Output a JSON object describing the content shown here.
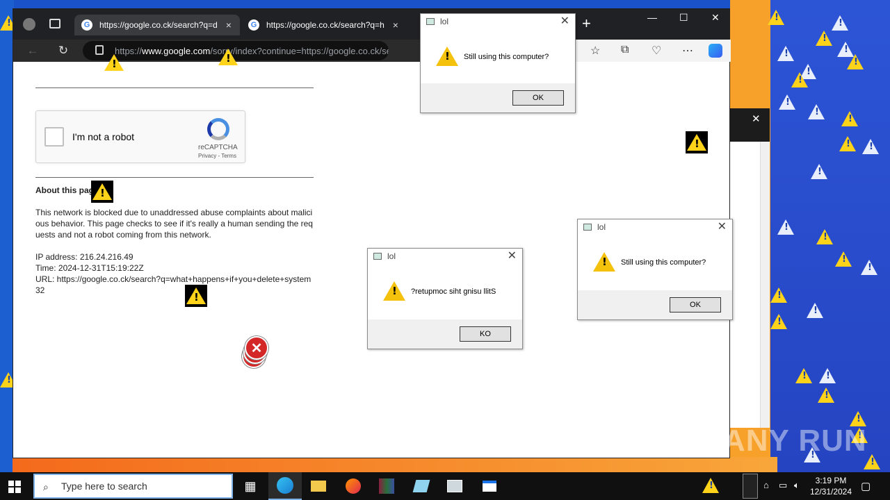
{
  "browser": {
    "tabs": [
      {
        "label": "https://google.co.ck/search?q=d",
        "close": "×"
      },
      {
        "label": "https://google.co.ck/search?q=h",
        "close": "×"
      }
    ],
    "new_tab": "+",
    "url_prefix": "https://",
    "url_domain": "www.google.com",
    "url_rest": "/sorry/index?continue=https://google.co.ck/sear",
    "window_controls": {
      "minimize": "—",
      "maximize": "☐",
      "close": "✕"
    }
  },
  "page": {
    "captcha": {
      "label": "I'm not a robot",
      "brand": "reCAPTCHA",
      "links": "Privacy - Terms"
    },
    "about_title": "About this page",
    "paragraph": "This network is blocked due to unaddressed abuse complaints about malicious behavior. This page checks to see if it's really a human sending the requests and not a robot coming from this network.",
    "ip": "IP address: 216.24.216.49",
    "time": "Time: 2024-12-31T15:19:22Z",
    "url": "URL: https://google.co.ck/search?q=what+happens+if+you+delete+system32"
  },
  "dialogs": [
    {
      "title": "lol",
      "message": "Still using this computer?",
      "button": "OK",
      "close": "✕"
    },
    {
      "title": "lol",
      "message": "?retupmoc siht gnisu llitS",
      "button": "KO",
      "close": "✕"
    },
    {
      "title": "lol",
      "message": "Still using this computer?",
      "button": "OK",
      "close": "✕"
    }
  ],
  "taskbar": {
    "search_placeholder": "Type here to search",
    "time": "3:19 PM",
    "date": "12/31/2024"
  },
  "watermark": "ANY RUN"
}
